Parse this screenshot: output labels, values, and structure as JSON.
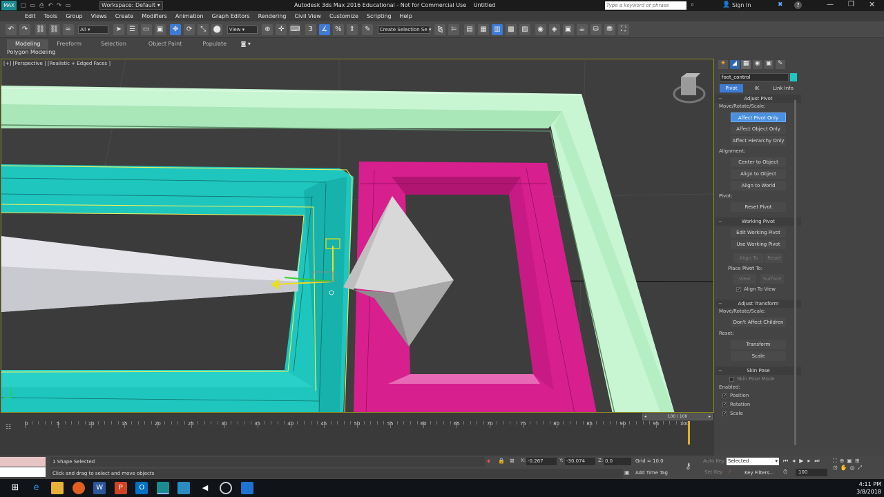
{
  "titlebar": {
    "workspace": "Workspace: Default",
    "title": "Autodesk 3ds Max 2016 Educational - Not for Commercial Use",
    "doc": "Untitled",
    "search_placeholder": "Type a keyword or phrase",
    "signin": "Sign In"
  },
  "menu": [
    "Edit",
    "Tools",
    "Group",
    "Views",
    "Create",
    "Modifiers",
    "Animation",
    "Graph Editors",
    "Rendering",
    "Civil View",
    "Customize",
    "Scripting",
    "Help"
  ],
  "toolbar": {
    "filter": "All",
    "refcoord": "View",
    "selset": "Create Selection Se"
  },
  "ribbon": {
    "tabs": [
      "Modeling",
      "Freeform",
      "Selection",
      "Object Paint",
      "Populate"
    ],
    "sub": "Polygon Modeling"
  },
  "viewport": {
    "label": "[+] [Perspective ] [Realistic + Edged Faces ]"
  },
  "cmd": {
    "object_name": "foot_control",
    "tabs": [
      "Pivot",
      "IK",
      "Link Info"
    ],
    "adjust_pivot": "Adjust Pivot",
    "mrs": "Move/Rotate/Scale:",
    "affect_pivot": "Affect Pivot Only",
    "affect_object": "Affect Object Only",
    "affect_hier": "Affect Hierarchy Only",
    "alignment": "Alignment:",
    "center": "Center to Object",
    "align_obj": "Align to Object",
    "align_world": "Align to World",
    "pivot_lbl": "Pivot:",
    "reset_pivot": "Reset Pivot",
    "working_pivot": "Working Pivot",
    "edit_wp": "Edit Working Pivot",
    "use_wp": "Use Working Pivot",
    "align_view": "Align To View",
    "reset": "Reset",
    "place_pivot": "Place Pivot To:",
    "view": "View",
    "surface": "Surface",
    "align_to_view_chk": "Align To View",
    "adjust_transform": "Adjust Transform",
    "mrs2": "Move/Rotate/Scale:",
    "dont_affect": "Don't Affect Children",
    "reset_lbl": "Reset:",
    "transform": "Transform",
    "scale": "Scale",
    "skin_pose": "Skin Pose",
    "skin_pose_mode": "Skin Pose Mode",
    "enabled": "Enabled:",
    "position": "Position",
    "rotation": "Rotation",
    "scale_chk": "Scale"
  },
  "timeline": {
    "frame": "100 / 100",
    "ticks": [
      "0",
      "5",
      "10",
      "15",
      "20",
      "25",
      "30",
      "35",
      "40",
      "45",
      "50",
      "55",
      "60",
      "65",
      "70",
      "75",
      "80",
      "85",
      "90",
      "95",
      "100"
    ],
    "current_frame": 100,
    "frame_max": 100
  },
  "status": {
    "selected": "1 Shape Selected",
    "prompt": "Click and drag to select and move objects",
    "x_label": "X:",
    "x": "-0.267",
    "y_label": "Y:",
    "y": "-30.074",
    "z_label": "Z:",
    "z": "0.0",
    "grid": "Grid = 10.0",
    "add_time_tag": "Add Time Tag",
    "auto_key": "Auto Key",
    "set_key": "Set Key",
    "selected_dd": "Selected",
    "key_filters": "Key Filters...",
    "frame_field": "100"
  },
  "taskbar": {
    "time": "4:11 PM",
    "date": "3/8/2018"
  },
  "colors": {
    "teal": "#1fc7c0",
    "magenta": "#e0229a",
    "mint": "#c4f3cf",
    "accent": "#4a8fe0"
  }
}
